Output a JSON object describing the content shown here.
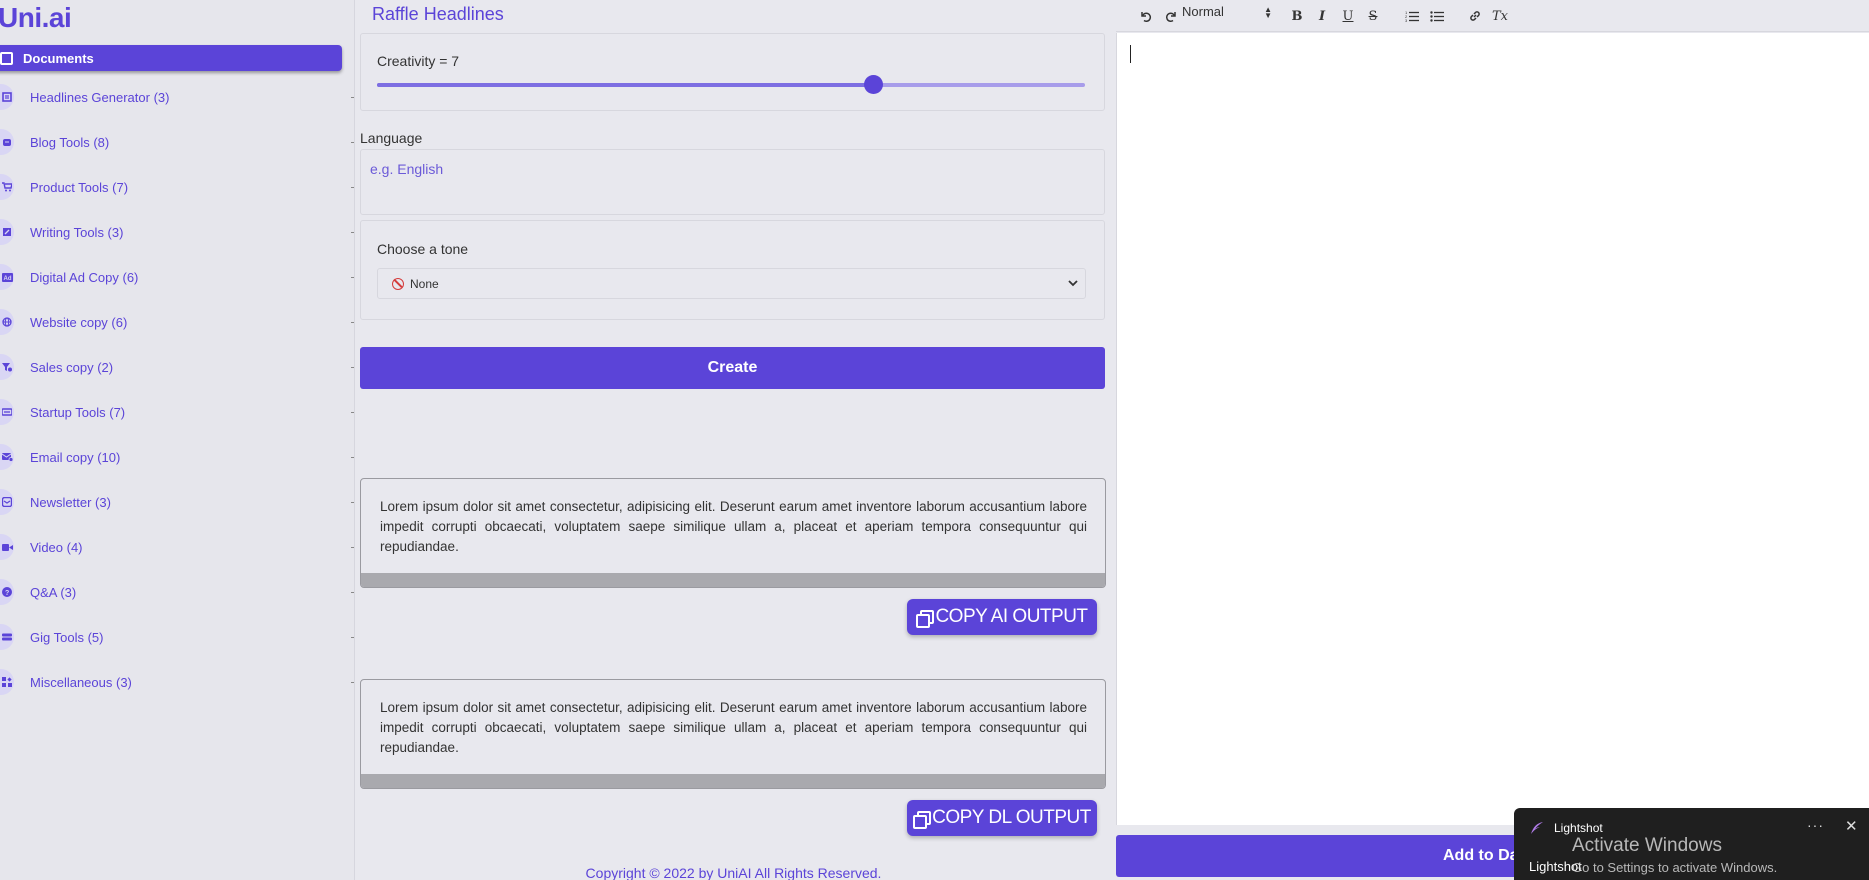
{
  "sidebar": {
    "logo": "Uni.ai",
    "documents_label": "Documents",
    "items": [
      {
        "label": "Headlines Generator (3)",
        "icon": "newspaper-icon"
      },
      {
        "label": "Blog Tools (8)",
        "icon": "blog-icon"
      },
      {
        "label": "Product Tools (7)",
        "icon": "cart-icon"
      },
      {
        "label": "Writing Tools (3)",
        "icon": "pen-icon"
      },
      {
        "label": "Digital Ad Copy (6)",
        "icon": "ad-icon"
      },
      {
        "label": "Website copy (6)",
        "icon": "globe-icon"
      },
      {
        "label": "Sales copy (2)",
        "icon": "sales-icon"
      },
      {
        "label": "Startup Tools (7)",
        "icon": "startup-icon"
      },
      {
        "label": "Email copy (10)",
        "icon": "email-icon"
      },
      {
        "label": "Newsletter (3)",
        "icon": "newsletter-icon"
      },
      {
        "label": "Video (4)",
        "icon": "video-icon"
      },
      {
        "label": "Q&A (3)",
        "icon": "question-icon"
      },
      {
        "label": "Gig Tools (5)",
        "icon": "gig-icon"
      },
      {
        "label": "Miscellaneous (3)",
        "icon": "misc-icon"
      }
    ]
  },
  "form": {
    "title": "Raffle Headlines",
    "creativity_label": "Creativity = 7",
    "creativity_value": 7,
    "creativity_max": 10,
    "language_label": "Language",
    "language_placeholder": "e.g. English",
    "tone_label": "Choose a tone",
    "tone_selected": "None",
    "create_label": "Create"
  },
  "outputs": [
    {
      "text": "Lorem ipsum dolor sit amet consectetur, adipisicing elit. Deserunt earum amet inventore laborum accusantium labore impedit corrupti obcaecati, voluptatem saepe similique ullam a, placeat et aperiam tempora consequuntur qui repudiandae.",
      "button": "COPY AI OUTPUT"
    },
    {
      "text": "Lorem ipsum dolor sit amet consectetur, adipisicing elit. Deserunt earum amet inventore laborum accusantium labore impedit corrupti obcaecati, voluptatem saepe similique ullam a, placeat et aperiam tempora consequuntur qui repudiandae.",
      "button": "COPY DL OUTPUT"
    }
  ],
  "copyright": "Copyright © 2022 by UniAI All Rights Reserved.",
  "editor": {
    "format_selected": "Normal",
    "toolbar": {
      "bold": "B",
      "italic": "I",
      "underline": "U",
      "strike": "S",
      "clear": "Tx"
    },
    "add_button": "Add to Da"
  },
  "toast": {
    "app": "Lightshot",
    "sub": "Lightshot"
  },
  "watermark": {
    "title": "Activate Windows",
    "subtitle": "Go to Settings to activate Windows."
  },
  "colors": {
    "accent": "#5b44d8",
    "background": "#e8e8ee"
  }
}
